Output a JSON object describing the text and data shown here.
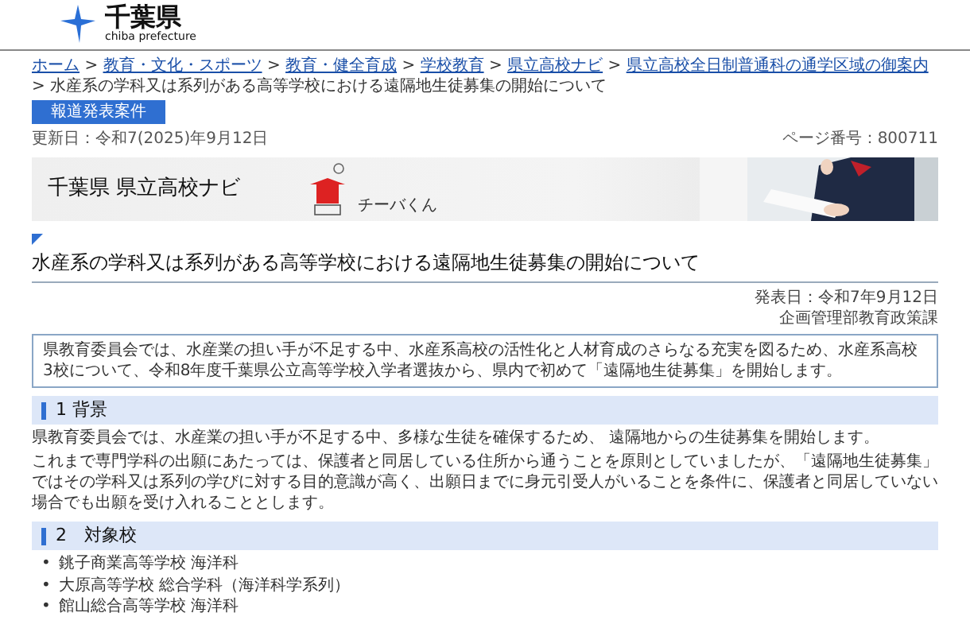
{
  "header": {
    "logo_title": "千葉県",
    "logo_subtitle": "chiba prefecture"
  },
  "breadcrumb": {
    "separator": ">",
    "links": [
      "ホーム",
      "教育・文化・スポーツ",
      "教育・健全育成",
      "学校教育",
      "県立高校ナビ",
      "県立高校全日制普通科の通学区域の御案内"
    ],
    "current": "水産系の学科又は系列がある高等学校における遠隔地生徒募集の開始について"
  },
  "press_button": "報道発表案件",
  "updated": "更新日：令和7(2025)年9月12日",
  "page_number": "ページ番号：800711",
  "banner": {
    "title": "千葉県 県立高校ナビ",
    "mascot_label": "チーバくん"
  },
  "title": "水産系の学科又は系列がある高等学校における遠隔地生徒募集の開始について",
  "published": "発表日：令和7年9月12日",
  "department": "企画管理部教育政策課",
  "summary": "県教育委員会では、水産業の担い手が不足する中、水産系高校の活性化と人材育成のさらなる充実を図るため、水産系高校3校について、令和8年度千葉県公立高等学校入学者選抜から、県内で初めて「遠隔地生徒募集」を開始します。",
  "sections": [
    {
      "heading": "1 背景",
      "paragraphs": [
        "県教育委員会では、水産業の担い手が不足する中、多様な生徒を確保するため、 遠隔地からの生徒募集を開始します。",
        "これまで専門学科の出願にあたっては、保護者と同居している住所から通うことを原則としていましたが、「遠隔地生徒募集」ではその学科又は系列の学びに対する目的意識が高く、出願日までに身元引受人がいることを条件に、保護者と同居していない場合でも出願を受け入れることとします。"
      ]
    },
    {
      "heading": "2　対象校",
      "bullet": "•",
      "items": [
        "銚子商業高等学校 海洋科",
        "大原高等学校 総合学科（海洋科学系列）",
        "館山総合高等学校 海洋科"
      ]
    }
  ]
}
